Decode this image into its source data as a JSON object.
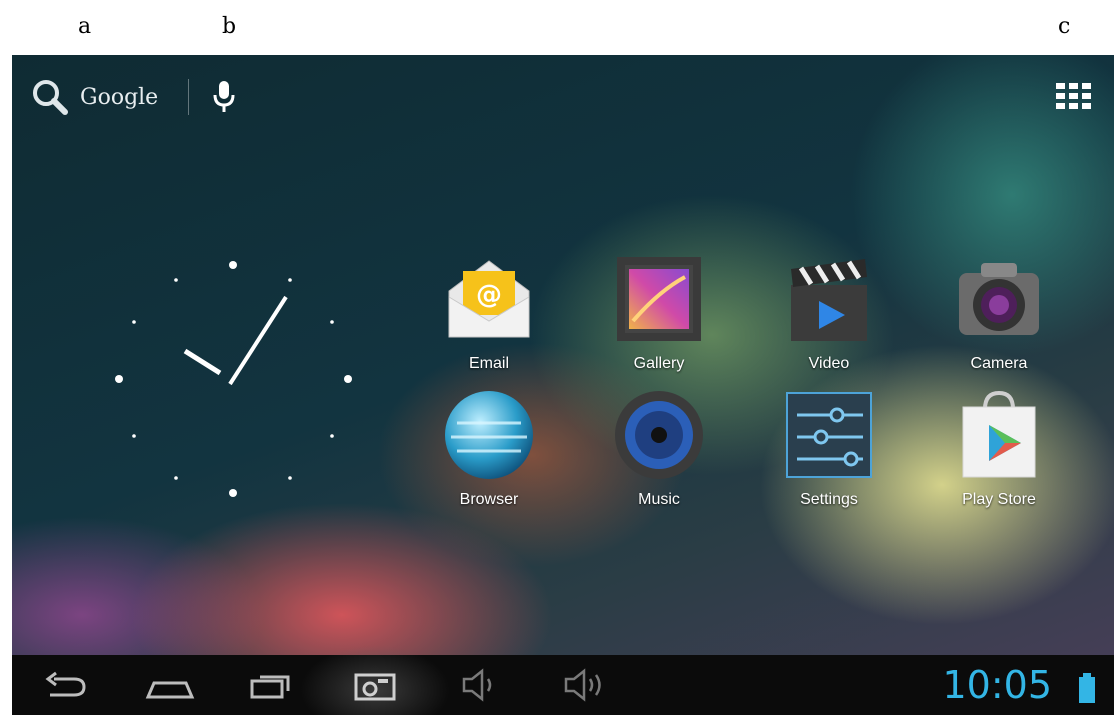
{
  "annotations": [
    "a",
    "b",
    "c"
  ],
  "search": {
    "label": "Google"
  },
  "apps": [
    {
      "label": "Email",
      "icon": "email-icon"
    },
    {
      "label": "Gallery",
      "icon": "gallery-icon"
    },
    {
      "label": "Video",
      "icon": "video-icon"
    },
    {
      "label": "Camera",
      "icon": "camera-icon"
    },
    {
      "label": "Browser",
      "icon": "browser-icon"
    },
    {
      "label": "Music",
      "icon": "music-icon"
    },
    {
      "label": "Settings",
      "icon": "settings-icon"
    },
    {
      "label": "Play Store",
      "icon": "play-store-icon"
    }
  ],
  "status": {
    "time": "10:05"
  },
  "colors": {
    "accent": "#33b5e5"
  }
}
